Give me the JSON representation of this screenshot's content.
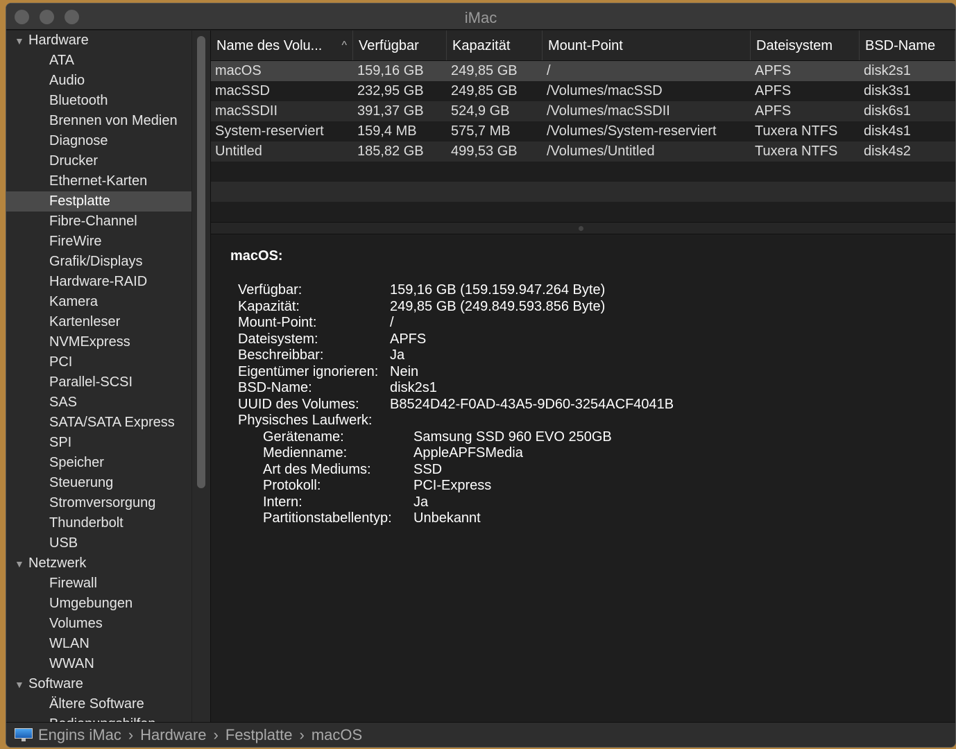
{
  "window": {
    "title": "iMac"
  },
  "sidebar": {
    "items": [
      {
        "label": "Hardware",
        "group": true
      },
      {
        "label": "ATA"
      },
      {
        "label": "Audio"
      },
      {
        "label": "Bluetooth"
      },
      {
        "label": "Brennen von Medien"
      },
      {
        "label": "Diagnose"
      },
      {
        "label": "Drucker"
      },
      {
        "label": "Ethernet-Karten"
      },
      {
        "label": "Festplatte",
        "selected": true
      },
      {
        "label": "Fibre-Channel"
      },
      {
        "label": "FireWire"
      },
      {
        "label": "Grafik/Displays"
      },
      {
        "label": "Hardware-RAID"
      },
      {
        "label": "Kamera"
      },
      {
        "label": "Kartenleser"
      },
      {
        "label": "NVMExpress"
      },
      {
        "label": "PCI"
      },
      {
        "label": "Parallel-SCSI"
      },
      {
        "label": "SAS"
      },
      {
        "label": "SATA/SATA Express"
      },
      {
        "label": "SPI"
      },
      {
        "label": "Speicher"
      },
      {
        "label": "Steuerung"
      },
      {
        "label": "Stromversorgung"
      },
      {
        "label": "Thunderbolt"
      },
      {
        "label": "USB"
      },
      {
        "label": "Netzwerk",
        "group": true
      },
      {
        "label": "Firewall"
      },
      {
        "label": "Umgebungen"
      },
      {
        "label": "Volumes"
      },
      {
        "label": "WLAN"
      },
      {
        "label": "WWAN"
      },
      {
        "label": "Software",
        "group": true
      },
      {
        "label": "Ältere Software"
      },
      {
        "label": "Bedienungshilfen"
      }
    ]
  },
  "table": {
    "columns": [
      "Name des Volu...",
      "Verfügbar",
      "Kapazität",
      "Mount-Point",
      "Dateisystem",
      "BSD-Name"
    ],
    "sort_indicator": "^",
    "rows": [
      [
        "macOS",
        "159,16 GB",
        "249,85 GB",
        "/",
        "APFS",
        "disk2s1"
      ],
      [
        "macSSD",
        "232,95 GB",
        "249,85 GB",
        "/Volumes/macSSD",
        "APFS",
        "disk3s1"
      ],
      [
        "macSSDII",
        "391,37 GB",
        "524,9 GB",
        "/Volumes/macSSDII",
        "APFS",
        "disk6s1"
      ],
      [
        "System-reserviert",
        "159,4 MB",
        "575,7 MB",
        "/Volumes/System-reserviert",
        "Tuxera NTFS",
        "disk4s1"
      ],
      [
        "Untitled",
        "185,82 GB",
        "499,53 GB",
        "/Volumes/Untitled",
        "Tuxera NTFS",
        "disk4s2"
      ]
    ]
  },
  "detail": {
    "title": "macOS:",
    "fields": [
      [
        "Verfügbar:",
        "159,16 GB (159.159.947.264 Byte)"
      ],
      [
        "Kapazität:",
        "249,85 GB (249.849.593.856 Byte)"
      ],
      [
        "Mount-Point:",
        "/"
      ],
      [
        "Dateisystem:",
        "APFS"
      ],
      [
        "Beschreibbar:",
        "Ja"
      ],
      [
        "Eigentümer ignorieren:",
        "Nein"
      ],
      [
        "BSD-Name:",
        "disk2s1"
      ],
      [
        "UUID des Volumes:",
        "B8524D42-F0AD-43A5-9D60-3254ACF4041B"
      ],
      [
        "Physisches Laufwerk:",
        ""
      ]
    ],
    "sub_fields": [
      [
        "Gerätename:",
        "Samsung SSD 960 EVO 250GB"
      ],
      [
        "Medienname:",
        "AppleAPFSMedia"
      ],
      [
        "Art des Mediums:",
        "SSD"
      ],
      [
        "Protokoll:",
        "PCI-Express"
      ],
      [
        "Intern:",
        "Ja"
      ],
      [
        "Partitionstabellentyp:",
        "Unbekannt"
      ]
    ]
  },
  "breadcrumb": [
    "Engins iMac",
    "Hardware",
    "Festplatte",
    "macOS"
  ],
  "breadcrumb_sep": "›"
}
